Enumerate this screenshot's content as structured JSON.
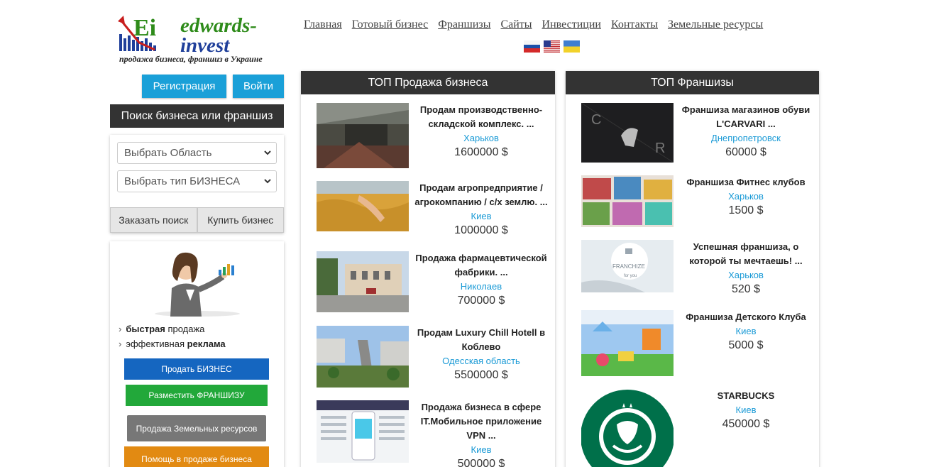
{
  "logo": {
    "name_line1": "edwards-",
    "name_line2": "invest",
    "tagline": "продажа бизнеса, франшиз в Украине",
    "mark_text": "Ei"
  },
  "nav": {
    "items": [
      "Главная",
      "Готовый бизнес",
      "Франшизы",
      "Сайты",
      "Инвестиции",
      "Контакты",
      "Земельные ресурсы"
    ]
  },
  "languages": [
    "ru",
    "en",
    "uk"
  ],
  "auth": {
    "register": "Регистрация",
    "login": "Войти"
  },
  "search": {
    "title": "Поиск бизнеса или франшиз",
    "region_placeholder": "Выбрать Область",
    "type_placeholder": "Выбрать тип БИЗНЕСА",
    "order_search": "Заказать поиск",
    "buy_business": "Купить бизнес"
  },
  "promo": {
    "bullet1_bold": "быстрая",
    "bullet1_rest": " продажа",
    "bullet2_pre": "эффективная ",
    "bullet2_bold": "реклама",
    "btn_sell": "Продать БИЗНЕС",
    "btn_franchise": "Разместить ФРАНШИЗУ",
    "btn_land": "Продажа Земельных ресурсов",
    "btn_help": "Помощь в продаже бизнеса"
  },
  "top_business": {
    "title": "ТОП Продажа бизнеса",
    "items": [
      {
        "title": "Продам производственно-складской комплекс. ...",
        "city": "Харьков",
        "price": "1600000 $"
      },
      {
        "title": "Продам агропредприятие / агрокомпанию / с/х землю. ...",
        "city": "Киев",
        "price": "1000000 $"
      },
      {
        "title": "Продажа фармацевтической фабрики. ...",
        "city": "Николаев",
        "price": "700000 $"
      },
      {
        "title": "Продам Luxury Chill Hotell в Коблево",
        "city": "Одесская область",
        "price": "5500000 $"
      },
      {
        "title": "Продажа бизнеса в сфере IT.Мобильное приложение VPN ...",
        "city": "Киев",
        "price": "500000 $"
      }
    ]
  },
  "top_franchise": {
    "title": "ТОП Франшизы",
    "items": [
      {
        "title": "Франшиза магазинов обуви L'CARVARI ...",
        "city": "Днепропетровск",
        "price": "60000 $"
      },
      {
        "title": "Франшиза Фитнес клубов",
        "city": "Харьков",
        "price": "1500 $"
      },
      {
        "title": "Успешная франшиза, о которой ты мечтаешь! ...",
        "city": "Харьков",
        "price": "520 $"
      },
      {
        "title": "Франшиза Детского Клуба",
        "city": "Киев",
        "price": "5000 $"
      },
      {
        "title": "STARBUCKS",
        "city": "Киев",
        "price": "450000 $"
      }
    ],
    "thumb_text": {
      "franchise": "FRANCHIZE",
      "franchise_sub": "for you"
    }
  }
}
